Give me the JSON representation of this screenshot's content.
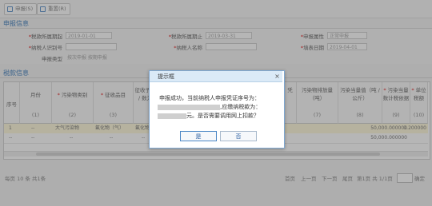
{
  "toolbar": {
    "buttons": [
      {
        "label": "申报(S)"
      },
      {
        "label": "重置(R)"
      }
    ]
  },
  "declare_section": {
    "title": "申报信息",
    "fields": [
      {
        "label": "税款所属期起",
        "value": "2019-01-01",
        "required": true
      },
      {
        "label": "税款所属期止",
        "value": "2019-03-31",
        "required": true
      },
      {
        "label": "申报属性",
        "value": "正常申报",
        "required": true
      },
      {
        "label": "纳税人识别号",
        "value": "",
        "required": true
      },
      {
        "label": "纳税人名称",
        "value": "",
        "required": true
      },
      {
        "label": "填表日期",
        "value": "2019-04-01",
        "required": true
      },
      {
        "label": "申报类型",
        "value": "按次申报  按期申报",
        "required": false
      }
    ]
  },
  "tax_section": {
    "title": "税款信息",
    "columns": [
      {
        "name": "序号",
        "index": "",
        "required": false
      },
      {
        "name": "月份",
        "index": "(1)",
        "required": false
      },
      {
        "name": "污染物类别",
        "index": "(2)",
        "required": true
      },
      {
        "name": "征收品目",
        "index": "(3)",
        "required": true
      },
      {
        "name": "征收子目 / 数为",
        "index": "",
        "required": false
      },
      {
        "name": "污染物排放量（吨）",
        "index": "(7)",
        "required": false
      },
      {
        "name": "污染当量值（吨 / 公斤）",
        "index": "(8)",
        "required": false
      },
      {
        "name": "污染当量数计税依据",
        "index": "(9)",
        "required": true
      },
      {
        "name": "单位税额",
        "index": "(10)",
        "required": true
      }
    ],
    "rows": [
      {
        "seq": "1",
        "month": "--",
        "category": "大气污染物",
        "item": "氟化物（气）",
        "sub": "氟化物（气",
        "equiv_num": "50,000.000000",
        "unit_tax": "1.200000"
      },
      {
        "seq": "--",
        "month": "--",
        "category": "--",
        "item": "--",
        "sub": "--",
        "equiv_num": "50,000.000000",
        "unit_tax": ""
      }
    ]
  },
  "pager": {
    "left_text": "每页 10 条  共1条",
    "first": "首页",
    "prev": "上一页",
    "next": "下一页",
    "last": "尾页",
    "page_info": "第1页  共 1/1页",
    "go": "确定"
  },
  "dialog": {
    "title": "提示框",
    "close": "×",
    "line1": "申报成功，当前纳税人申报凭证序号为：",
    "line2_suffix": ",应缴纳税款为：",
    "line3_suffix": "元。是否需要调用网上扣款？",
    "yes_label": "是",
    "no_label": "否"
  },
  "colors": {
    "accent": "#2a6fb5",
    "dialog_header": "#dbeaf7",
    "highlight_row": "#fff8d8"
  }
}
